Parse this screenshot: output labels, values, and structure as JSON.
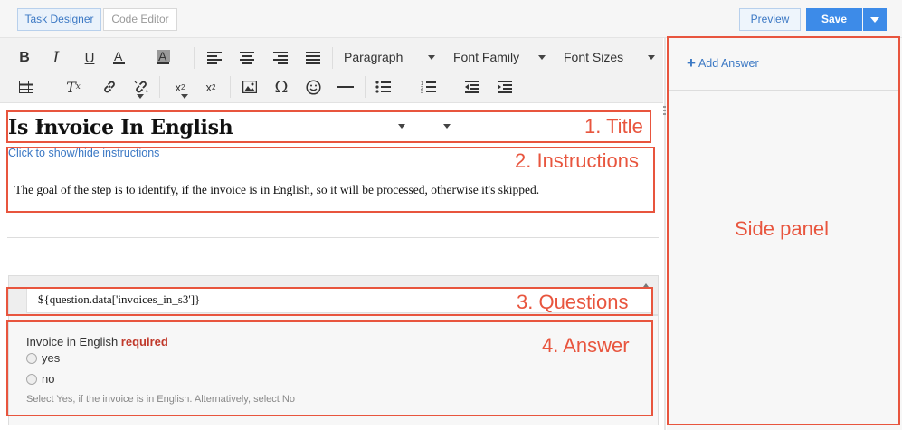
{
  "header": {
    "tabs": [
      {
        "label": "Task Designer",
        "active": true
      },
      {
        "label": "Code Editor",
        "active": false
      }
    ],
    "preview_label": "Preview",
    "save_label": "Save"
  },
  "toolbar": {
    "row1": [
      "bold-icon",
      "italic-icon",
      "underline-icon",
      "text-color-icon",
      "background-color-icon",
      "align-left-icon",
      "align-center-icon",
      "align-right-icon",
      "align-justify-icon"
    ],
    "format_select": "Paragraph",
    "font_family_select": "Font Family",
    "font_size_select": "Font Sizes",
    "row2": [
      "table-icon",
      "clear-formatting-icon",
      "link-icon",
      "unlink-icon",
      "subscript-icon",
      "superscript-icon",
      "image-icon",
      "special-char-icon",
      "emoji-icon",
      "horizontal-rule-icon",
      "bullet-list-icon",
      "numbered-list-icon",
      "outdent-icon",
      "indent-icon"
    ]
  },
  "content": {
    "title": "Is Invoice In English",
    "toggle_link": "Click to show/hide instructions",
    "instructions": "The goal of the step is to identify, if the invoice is in English, so it will be processed, otherwise it's skipped.",
    "question": "${question.data['invoices_in_s3']}",
    "answer": {
      "label": "Invoice in English",
      "required": "required",
      "options": [
        "yes",
        "no"
      ],
      "hint": "Select Yes, if the invoice is in English. Alternatively, select No"
    }
  },
  "side_panel": {
    "add_answer": "Add Answer"
  },
  "annotations": {
    "title": "1. Title",
    "instructions": "2. Instructions",
    "questions": "3. Questions",
    "answer": "4. Answer",
    "side_panel": "Side panel",
    "color": "#e8553e"
  },
  "colors": {
    "accent": "#3d8be8",
    "link": "#3b78c4",
    "required": "#c0392b"
  }
}
